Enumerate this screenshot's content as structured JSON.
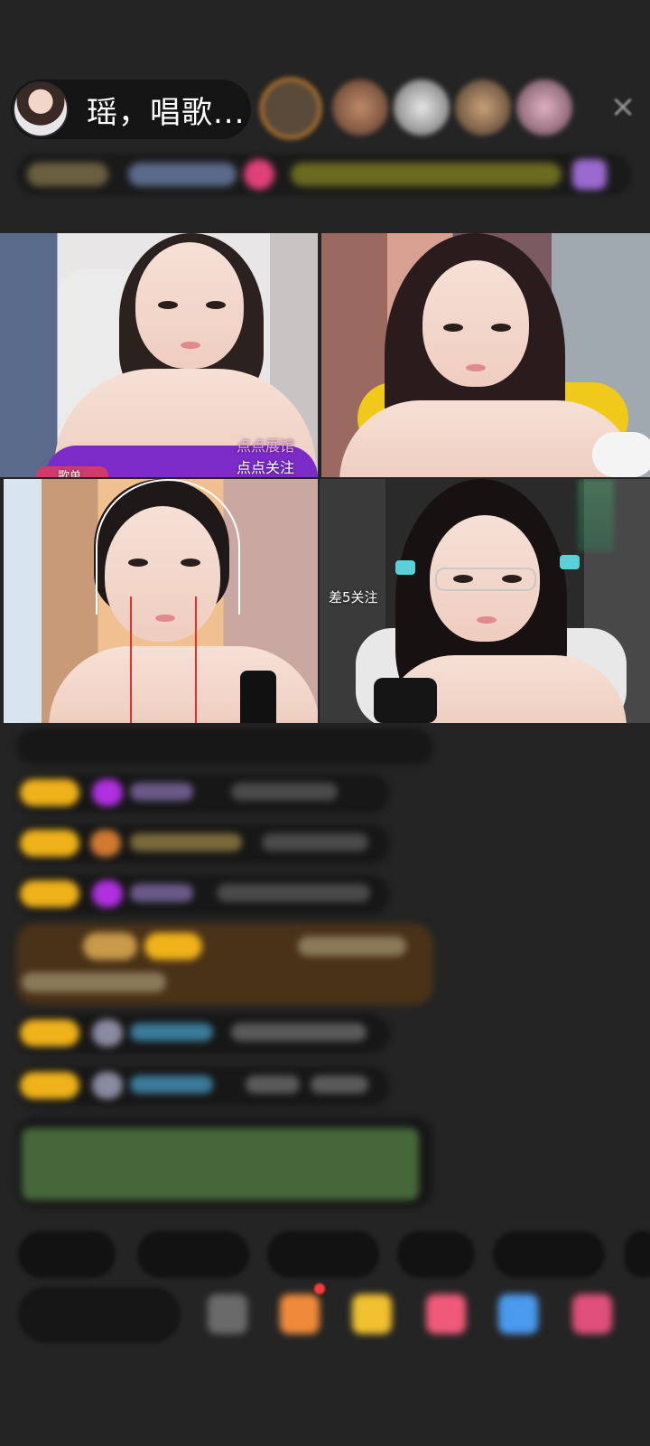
{
  "header": {
    "host_name": "瑶，唱歌...",
    "close_glyph": "×"
  },
  "viewers": [
    {
      "color": "#e08a2a"
    },
    {
      "color": "#b07a5a"
    },
    {
      "color": "#d8d8d8"
    },
    {
      "color": "#c49a72"
    },
    {
      "color": "#d0a0b0"
    }
  ],
  "tiles": {
    "top_left": {
      "line1": "点点展馆",
      "line2": "点点关注",
      "tag": "歌单"
    },
    "bottom_right": {
      "follow_gap": "差5关注"
    }
  },
  "colors": {
    "background": "#242424",
    "badge_yellow": "#f0b21a",
    "chat_bubble": "#171717",
    "highlight_bubble": "#4a3218"
  }
}
